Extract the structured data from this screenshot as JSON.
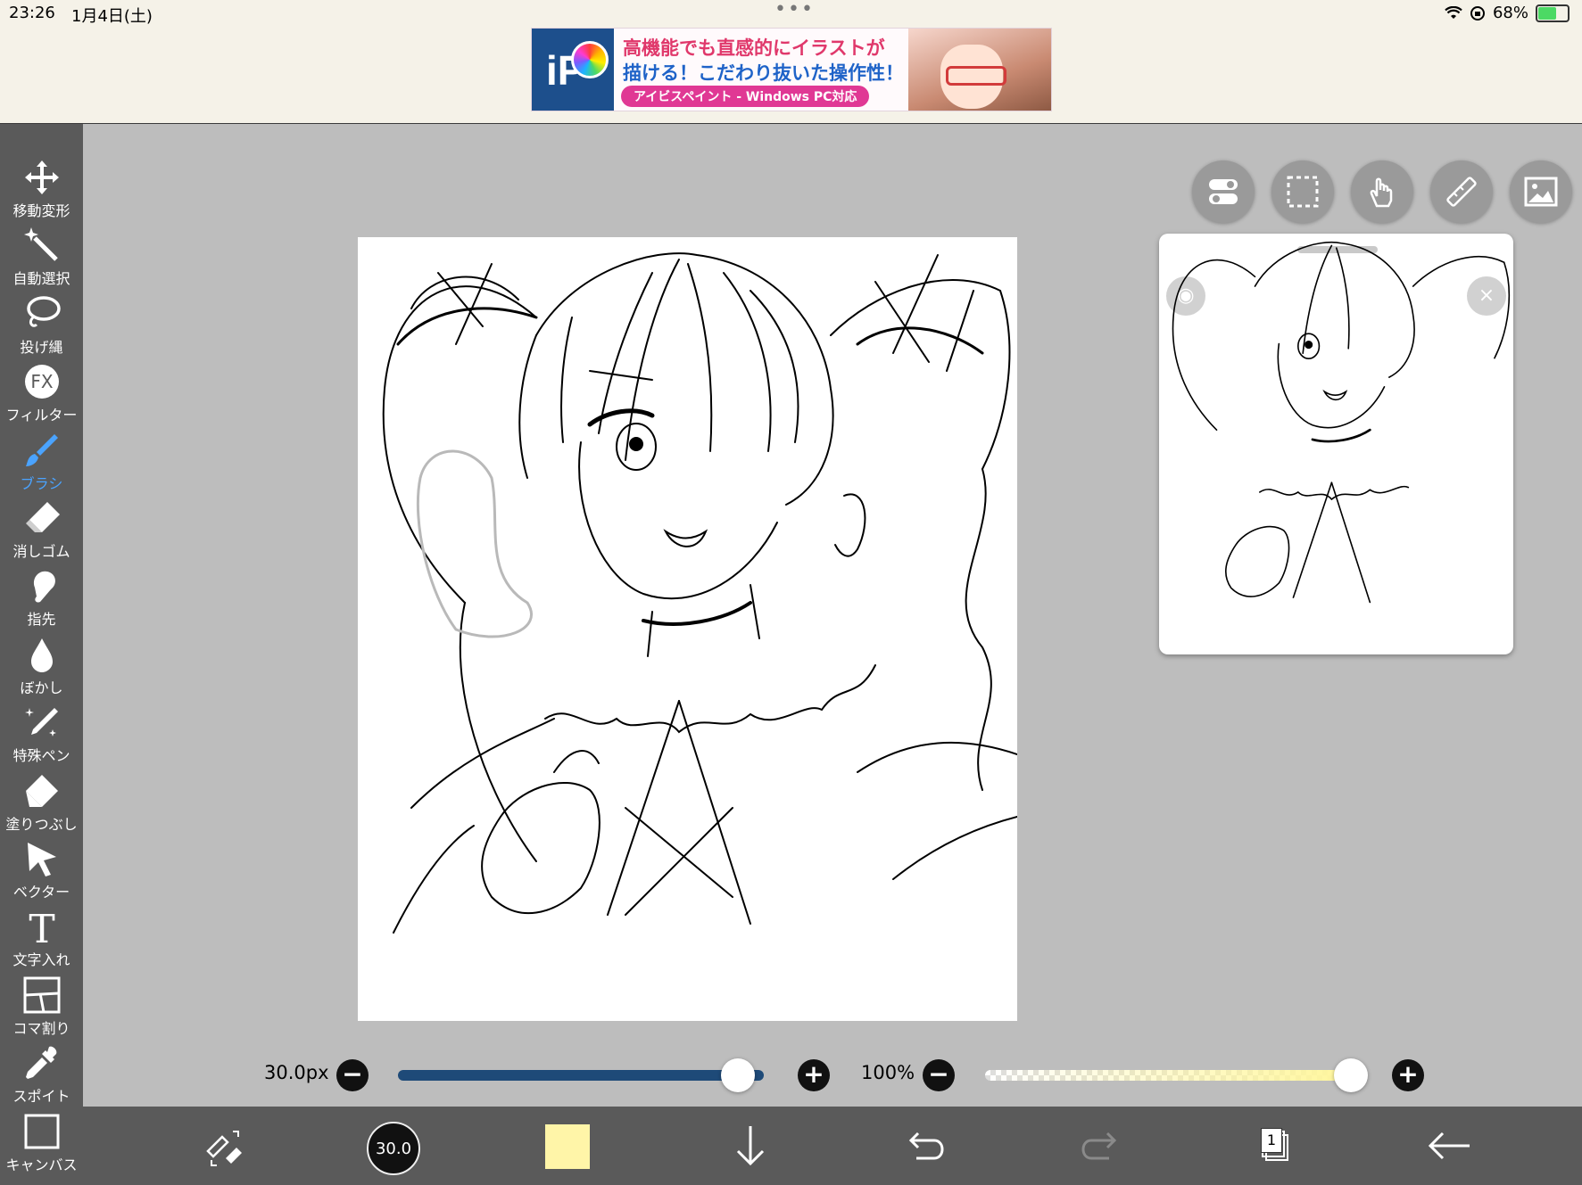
{
  "status_bar": {
    "time": "23:26",
    "date": "1月4日(土)",
    "battery": "68%",
    "battery_level": 0.68
  },
  "ad": {
    "line1": "高機能でも直感的にイラストが",
    "line2": "描ける！こだわり抜いた操作性！",
    "line3": "アイビスペイント - Windows PC対応"
  },
  "tools": [
    {
      "label": "移動変形",
      "icon": "move-icon"
    },
    {
      "label": "自動選択",
      "icon": "magic-wand-icon"
    },
    {
      "label": "投げ縄",
      "icon": "lasso-icon"
    },
    {
      "label": "フィルター",
      "icon": "fx-icon",
      "glyph": "FX"
    },
    {
      "label": "ブラシ",
      "icon": "brush-icon",
      "active": true
    },
    {
      "label": "消しゴム",
      "icon": "eraser-icon"
    },
    {
      "label": "指先",
      "icon": "smudge-icon"
    },
    {
      "label": "ぼかし",
      "icon": "blur-drop-icon"
    },
    {
      "label": "特殊ペン",
      "icon": "special-pen-icon"
    },
    {
      "label": "塗りつぶし",
      "icon": "fill-bucket-icon"
    },
    {
      "label": "ベクター",
      "icon": "vector-arrow-icon"
    },
    {
      "label": "文字入れ",
      "icon": "text-icon",
      "glyph": "T"
    },
    {
      "label": "コマ割り",
      "icon": "frame-divider-icon"
    },
    {
      "label": "スポイト",
      "icon": "eyedropper-icon"
    },
    {
      "label": "キャンバス",
      "icon": "canvas-icon"
    }
  ],
  "sliders": {
    "brush_size": "30.0px",
    "brush_size_level": 0.93,
    "opacity": "100%",
    "opacity_level": 1.0
  },
  "bottom_bar": {
    "brush_size_short": "30.0",
    "current_color": "#fff5a8",
    "layer_count": "1"
  },
  "colors": {
    "toolbar": "#5a5a5a",
    "active_tool": "#4aa3ff",
    "slider_fill": "#1e4a78"
  }
}
